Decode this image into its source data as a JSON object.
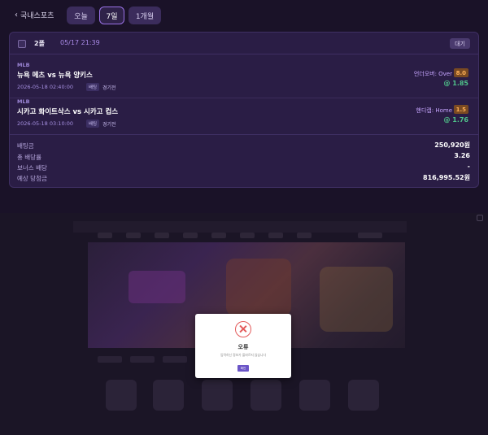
{
  "header": {
    "back_label": "국내스포츠",
    "tabs": [
      {
        "label": "오늘",
        "active": false
      },
      {
        "label": "7일",
        "active": true
      },
      {
        "label": "1개월",
        "active": false
      }
    ]
  },
  "slip": {
    "folder": "2폴",
    "datetime": "05/17 21:39",
    "status": "대기",
    "bets": [
      {
        "league": "MLB",
        "teams": "뉴욕 메츠 vs 뉴욕 양키스",
        "date": "2026-05-18 02:40:00",
        "tag_market": "배팅",
        "tag_stage": "경기전",
        "pick": "언더오버: Over",
        "line": "8.0",
        "odds": "@ 1.85"
      },
      {
        "league": "MLB",
        "teams": "시카고 화이트삭스 vs 시카고 컵스",
        "date": "2026-05-18 03:10:00",
        "tag_market": "배팅",
        "tag_stage": "경기전",
        "pick": "핸디캡: Home",
        "line": "1.5",
        "odds": "@ 1.76"
      }
    ],
    "summary": [
      {
        "label": "배팅금",
        "value": "250,920원"
      },
      {
        "label": "총 배당률",
        "value": "3.26"
      },
      {
        "label": "보너스 배당",
        "value": "-"
      },
      {
        "label": "예상 당첨금",
        "value": "816,995.52원"
      }
    ]
  },
  "modal": {
    "title": "오류",
    "message": "입력하신 정보가 올바르지 않습니다",
    "confirm_label": "확인"
  },
  "colors": {
    "accent": "#9a72e6",
    "error": "#e35a5a",
    "odds_green": "#4fc38a",
    "line_badge": "#ffb158"
  }
}
